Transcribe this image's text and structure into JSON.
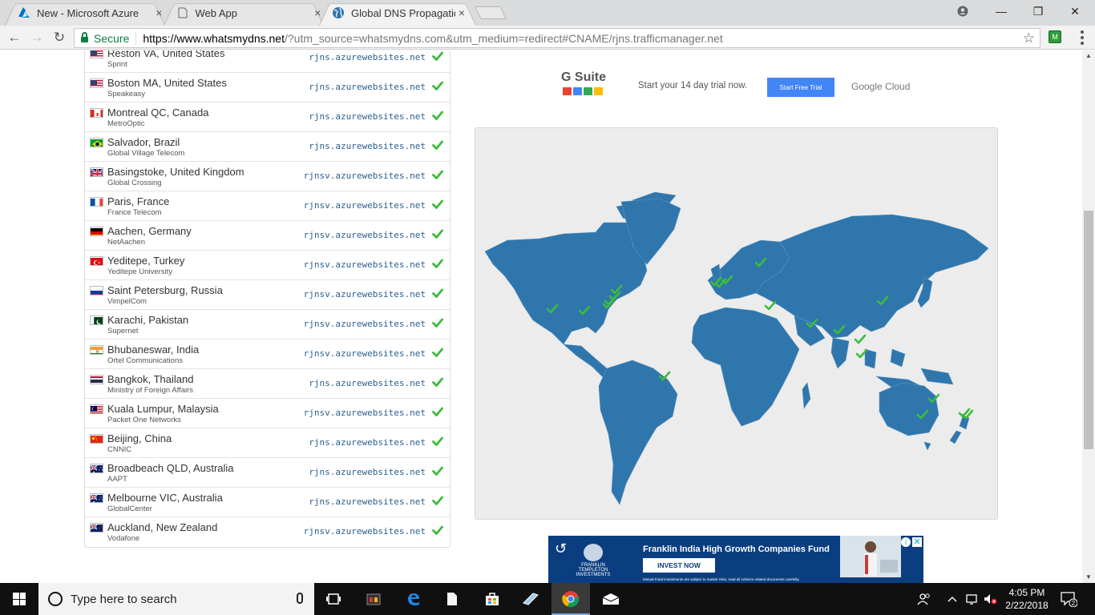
{
  "browser": {
    "tabs": [
      {
        "title": "New - Microsoft Azure",
        "icon": "azure-icon",
        "active": false
      },
      {
        "title": "Web App",
        "icon": "document-icon",
        "active": false
      },
      {
        "title": "Global DNS Propagation",
        "icon": "globe-icon",
        "active": true
      }
    ],
    "tab_close": "×",
    "secure_label": "Secure",
    "url_main": "https://www.whatsmydns.net",
    "url_rest": "/?utm_source=whatsmydns.com&utm_medium=redirect#CNAME/rjns.trafficmanager.net",
    "window_controls": {
      "minimize": "—",
      "maximize": "❐",
      "close": "✕"
    }
  },
  "results": [
    {
      "location": "Reston VA, United States",
      "isp": "Sprint",
      "value": "rjns.azurewebsites.net",
      "flag": "us"
    },
    {
      "location": "Boston MA, United States",
      "isp": "Speakeasy",
      "value": "rjns.azurewebsites.net",
      "flag": "us"
    },
    {
      "location": "Montreal QC, Canada",
      "isp": "MetroOptic",
      "value": "rjns.azurewebsites.net",
      "flag": "ca"
    },
    {
      "location": "Salvador, Brazil",
      "isp": "Global Village Telecom",
      "value": "rjns.azurewebsites.net",
      "flag": "br"
    },
    {
      "location": "Basingstoke, United Kingdom",
      "isp": "Global Crossing",
      "value": "rjnsv.azurewebsites.net",
      "flag": "gb"
    },
    {
      "location": "Paris, France",
      "isp": "France Telecom",
      "value": "rjnsv.azurewebsites.net",
      "flag": "fr"
    },
    {
      "location": "Aachen, Germany",
      "isp": "NetAachen",
      "value": "rjnsv.azurewebsites.net",
      "flag": "de"
    },
    {
      "location": "Yeditepe, Turkey",
      "isp": "Yeditepe University",
      "value": "rjnsv.azurewebsites.net",
      "flag": "tr"
    },
    {
      "location": "Saint Petersburg, Russia",
      "isp": "VimpelCom",
      "value": "rjnsv.azurewebsites.net",
      "flag": "ru"
    },
    {
      "location": "Karachi, Pakistan",
      "isp": "Supernet",
      "value": "rjnsv.azurewebsites.net",
      "flag": "pk"
    },
    {
      "location": "Bhubaneswar, India",
      "isp": "Ortel Communications",
      "value": "rjnsv.azurewebsites.net",
      "flag": "in"
    },
    {
      "location": "Bangkok, Thailand",
      "isp": "Ministry of Foreign Affairs",
      "value": "rjns.azurewebsites.net",
      "flag": "th"
    },
    {
      "location": "Kuala Lumpur, Malaysia",
      "isp": "Packet One Networks",
      "value": "rjnsv.azurewebsites.net",
      "flag": "my"
    },
    {
      "location": "Beijing, China",
      "isp": "CNNIC",
      "value": "rjns.azurewebsites.net",
      "flag": "cn"
    },
    {
      "location": "Broadbeach QLD, Australia",
      "isp": "AAPT",
      "value": "rjns.azurewebsites.net",
      "flag": "au"
    },
    {
      "location": "Melbourne VIC, Australia",
      "isp": "GlobalCenter",
      "value": "rjns.azurewebsites.net",
      "flag": "au"
    },
    {
      "location": "Auckland, New Zealand",
      "isp": "Vodafone",
      "value": "rjnsv.azurewebsites.net",
      "flag": "nz"
    }
  ],
  "gsuite_ad": {
    "logo": "G Suite",
    "text": "Start your 14 day trial now.",
    "button": "Start Free Trial",
    "partner": "Google Cloud"
  },
  "bottom_ad": {
    "brand": "FRANKLIN TEMPLETON INVESTMENTS",
    "title": "Franklin India High Growth Companies Fund",
    "button": "INVEST NOW",
    "disclaimer": "Mutual Fund investments are subject to market risks, read all scheme related documents carefully."
  },
  "taskbar": {
    "search_placeholder": "Type here to search",
    "time": "4:05 PM",
    "date": "2/22/2018",
    "notification_count": "2"
  },
  "colors": {
    "check": "#3cbc3c",
    "map_land": "#2f76ad",
    "map_bg": "#ececec",
    "secure": "#0b8043"
  }
}
